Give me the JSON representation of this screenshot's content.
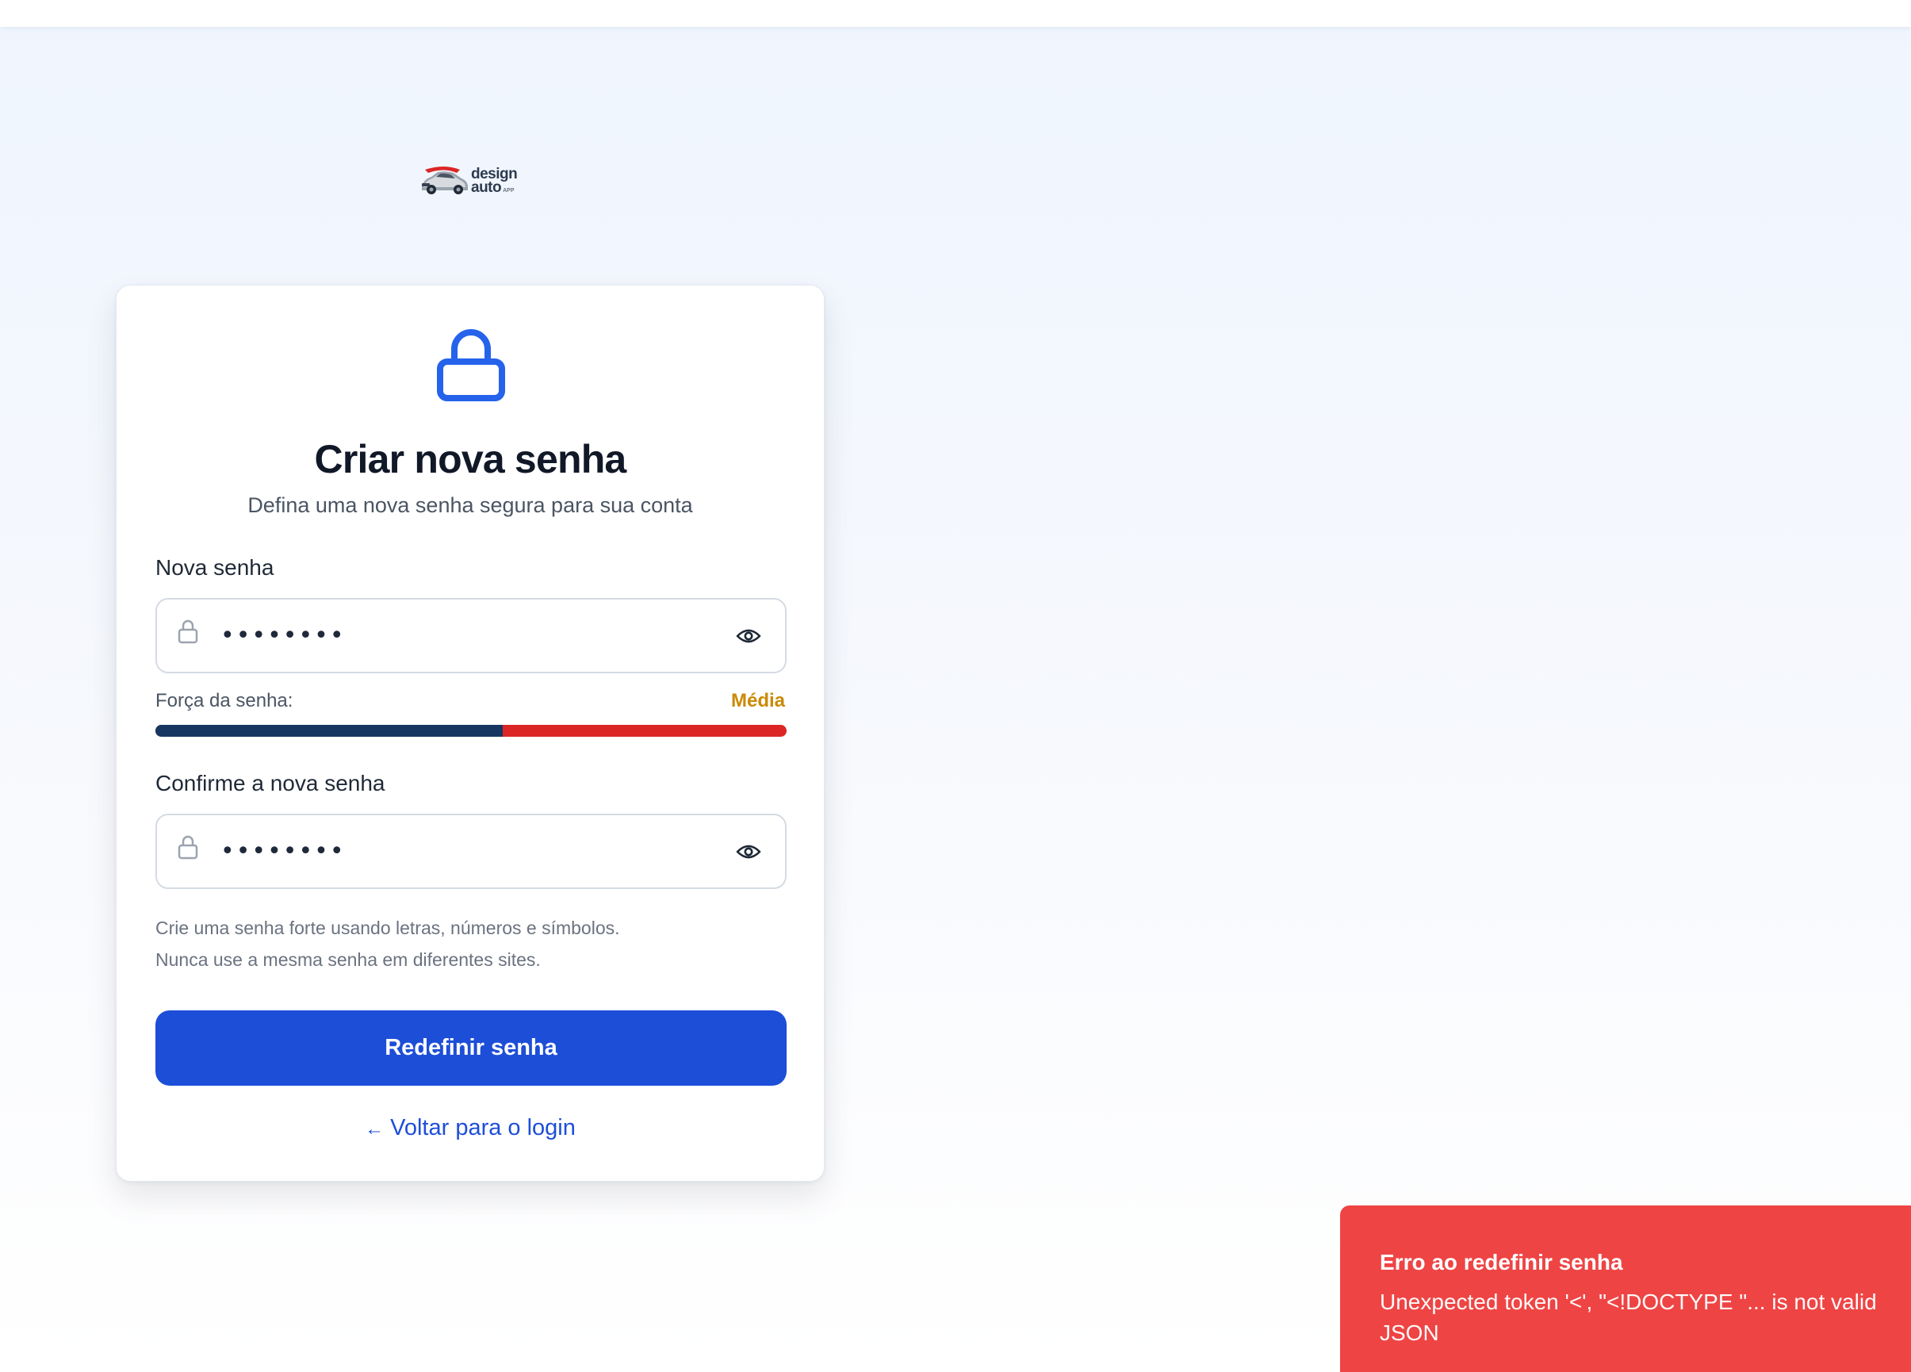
{
  "brand": {
    "line1": "design",
    "line2": "auto",
    "suffix": "APP"
  },
  "card": {
    "title": "Criar nova senha",
    "subtitle": "Defina uma nova senha segura para sua conta"
  },
  "new_password": {
    "label": "Nova senha",
    "value_masked": "••••••••"
  },
  "strength": {
    "label": "Força da senha:",
    "value": "Média",
    "level_fraction": 0.55,
    "colors": {
      "filled": "#163661",
      "remaining": "#dc2626",
      "value_text": "#ca8a04"
    }
  },
  "confirm_password": {
    "label": "Confirme a nova senha",
    "value_masked": "••••••••"
  },
  "hints": {
    "line1": "Crie uma senha forte usando letras, números e símbolos.",
    "line2": "Nunca use a mesma senha em diferentes sites."
  },
  "submit_label": "Redefinir senha",
  "back_link": {
    "arrow": "←",
    "label": "Voltar para o login"
  },
  "toast": {
    "title": "Erro ao redefinir senha",
    "message": "Unexpected token '<', \"<!DOCTYPE \"... is not valid JSON",
    "color": "#ef4444"
  },
  "icons": {
    "hero": "lock-icon",
    "field": "lock-icon",
    "toggle": "eye-icon"
  },
  "accent_color": "#1d4ed8"
}
